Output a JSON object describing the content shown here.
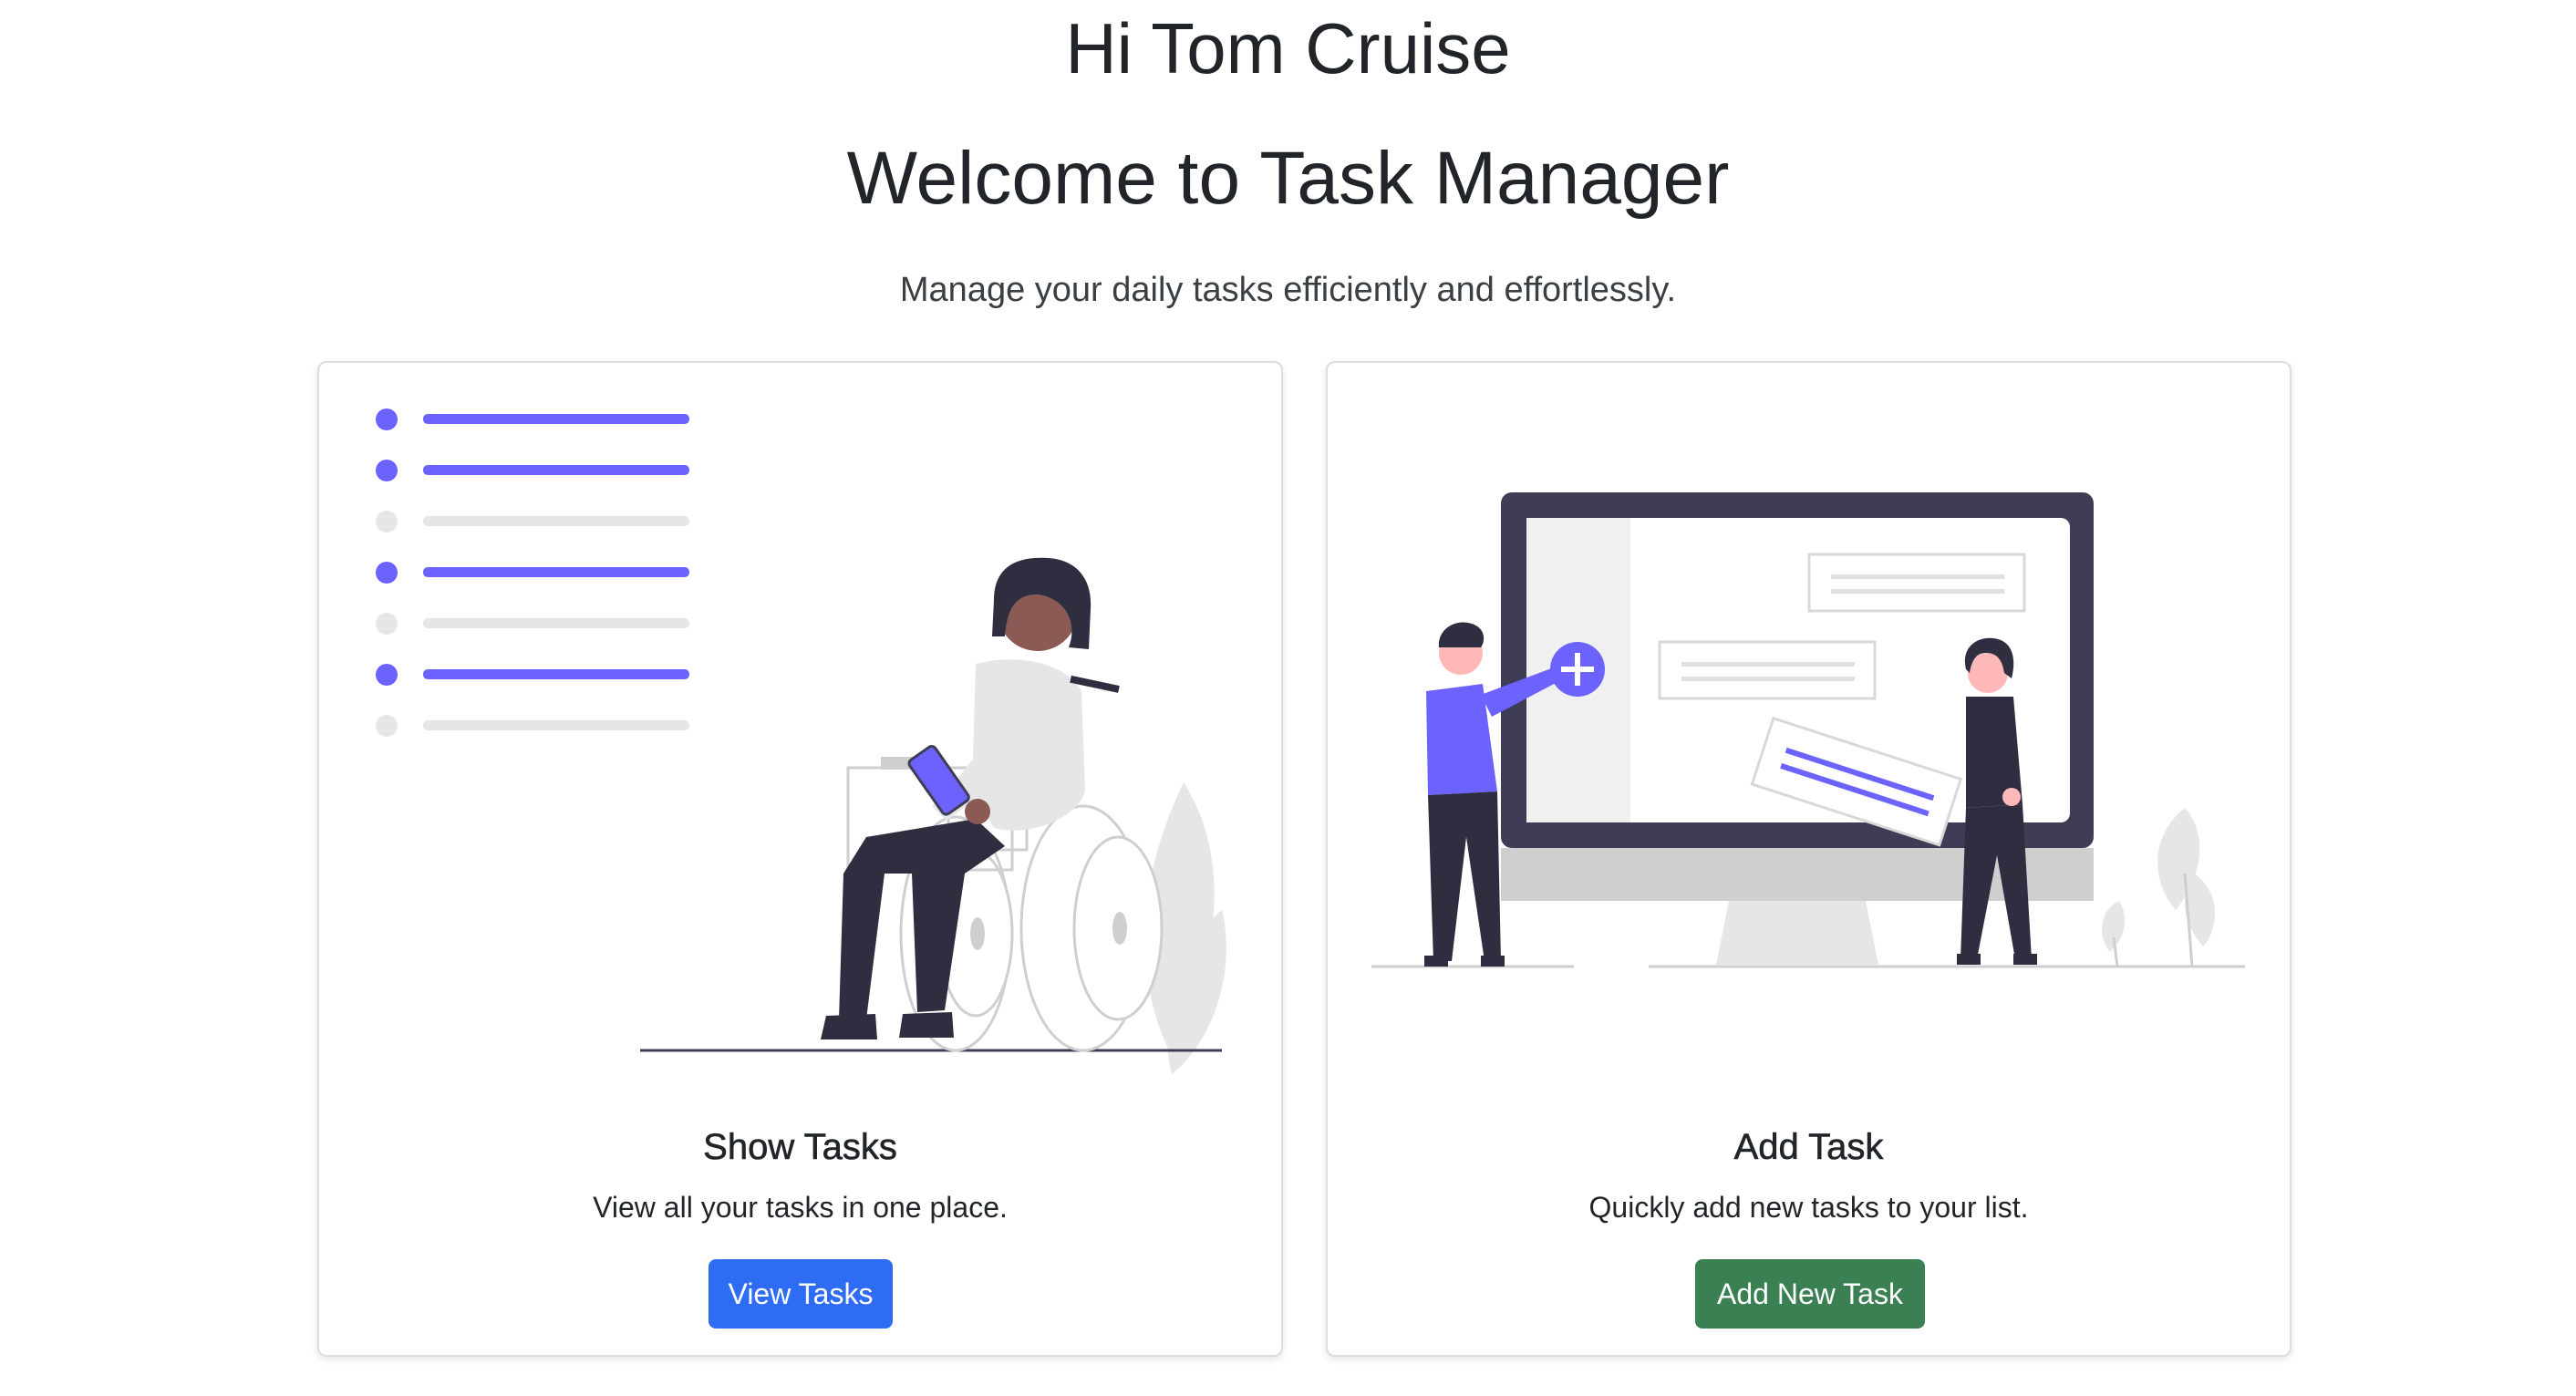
{
  "header": {
    "greeting": "Hi Tom Cruise",
    "title": "Welcome to Task Manager",
    "tagline": "Manage your daily tasks efficiently and effortlessly."
  },
  "cards": [
    {
      "title": "Show Tasks",
      "text": "View all your tasks in one place.",
      "button_label": "View Tasks",
      "illustration_icon": "task-list-wheelchair-illustration"
    },
    {
      "title": "Add Task",
      "text": "Quickly add new tasks to your list.",
      "button_label": "Add New Task",
      "illustration_icon": "add-task-monitor-illustration"
    }
  ],
  "colors": {
    "accent": "#6c63ff",
    "primary_button": "#2f6cf4",
    "success_button": "#3a8052",
    "dark": "#3f3d56"
  }
}
